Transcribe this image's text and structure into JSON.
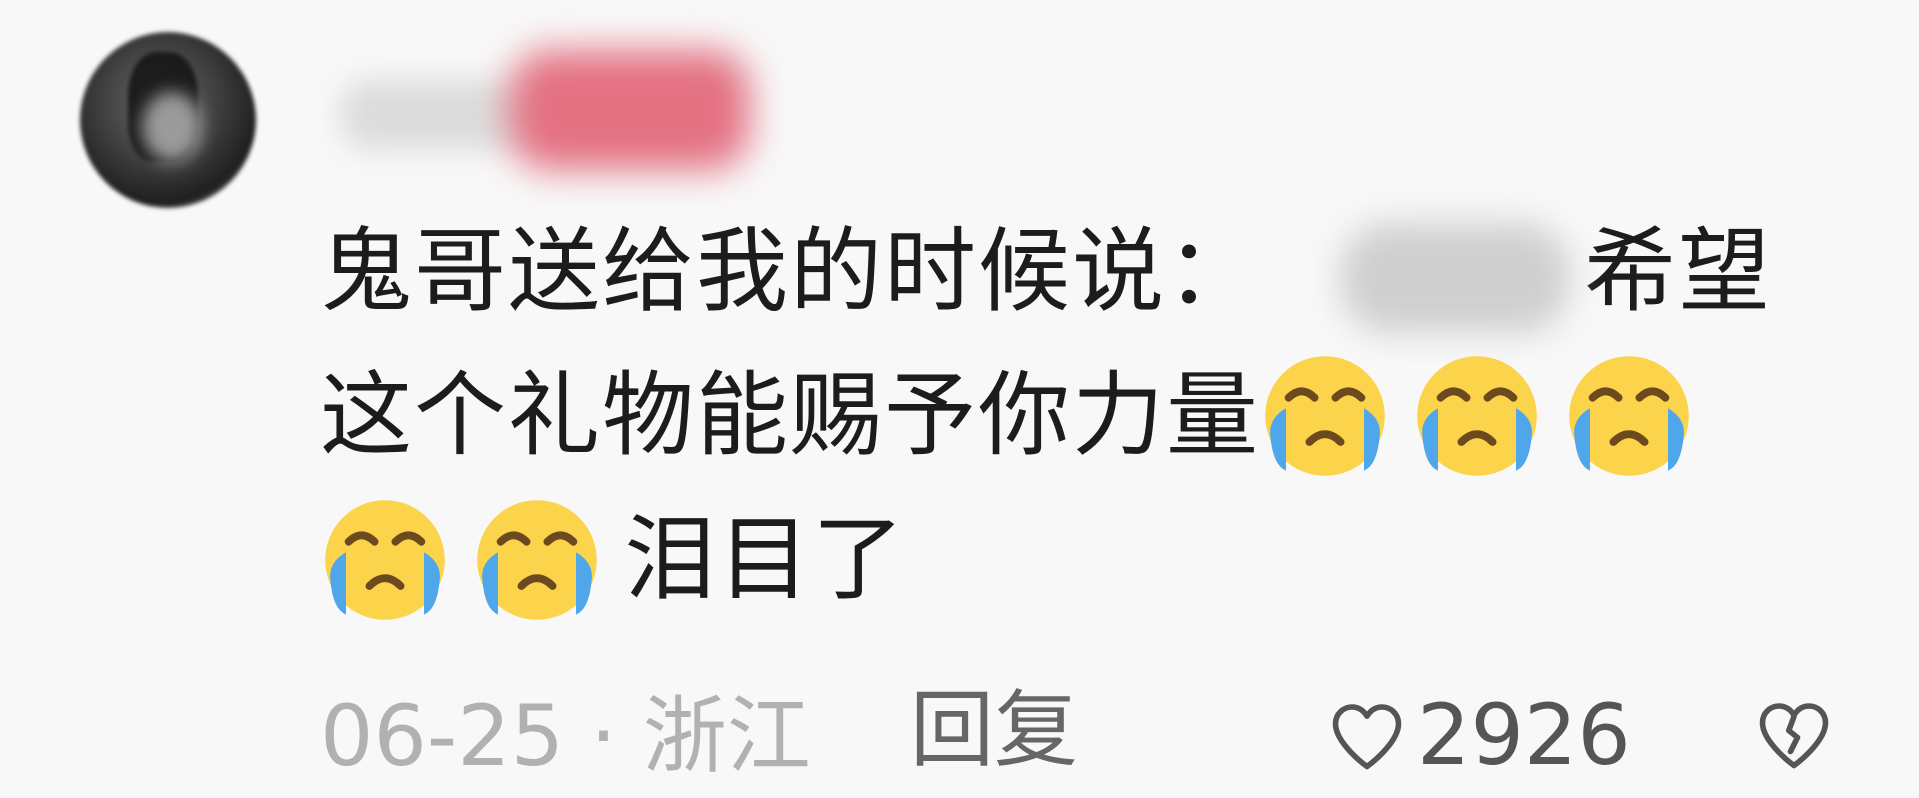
{
  "comment": {
    "avatar_icon": "user-avatar",
    "text_lines": [
      {
        "before_censor": "鬼哥送给我的时候说：",
        "after_censor": "希望"
      },
      {
        "text": "这个礼物能赐予你力量"
      },
      {
        "text": "泪目了"
      }
    ],
    "emoji_name": "loudly-crying-face",
    "meta": {
      "date": "06-25",
      "separator": "·",
      "location": "浙江"
    },
    "reply_label": "回复",
    "like_count": "2926",
    "like_icon": "heart-outline-icon",
    "dislike_icon": "broken-heart-icon",
    "colors": {
      "text": "#1c1c1c",
      "meta": "#b1b1b1",
      "emoji_face": "#fbd44b",
      "emoji_tears": "#4fa6ea"
    }
  }
}
